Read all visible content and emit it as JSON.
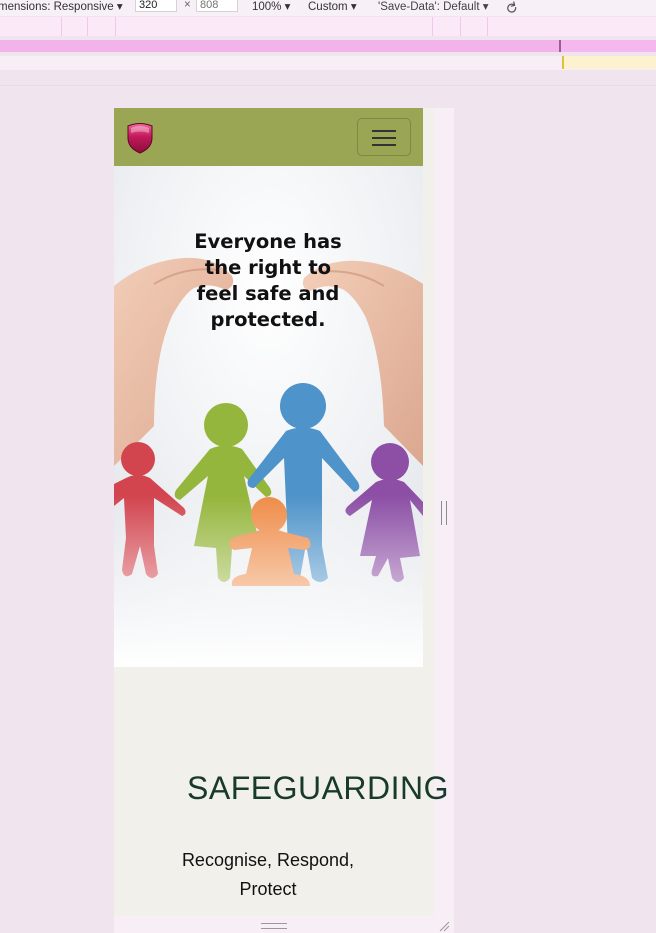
{
  "toolbar": {
    "dimensions_label": "mensions: Responsive ▾",
    "width_value": "320",
    "times": "×",
    "height_placeholder": "808",
    "zoom_label": "100% ▾",
    "throttle_label": "Custom ▾",
    "save_data_label": "'Save-Data': Default ▾",
    "rotate_icon": "rotate-icon"
  },
  "site": {
    "logo_icon": "shield-icon",
    "menu_icon": "hamburger-icon",
    "hero": {
      "heading": "Everyone has the right to feel safe and protected."
    },
    "section": {
      "title": "SAFEGUARDING",
      "subtitle": "Recognise, Respond, Protect"
    },
    "colors": {
      "navbar": "#9aa653",
      "logo": "#b0134a",
      "section_title": "#173a2a",
      "page_background": "#f2f0eb"
    }
  }
}
